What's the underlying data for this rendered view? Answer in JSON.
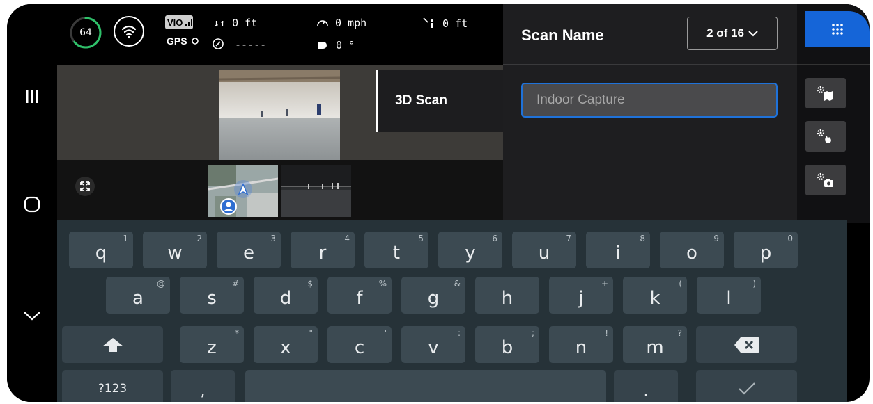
{
  "navbar": {
    "items": [
      {
        "name": "recent-apps",
        "glyph": "|||"
      },
      {
        "name": "home",
        "glyph": "○"
      },
      {
        "name": "back",
        "glyph": "∨"
      }
    ]
  },
  "status": {
    "battery_value": "64",
    "battery_percent": 64,
    "vio_label": "VIO",
    "gps_label": "GPS",
    "altitude": "↓↑ 0 ft",
    "heading": "-----",
    "speed": "0 mph",
    "distance": "0 ft",
    "gimbal_angle": "0 °"
  },
  "camera": {
    "mode_label": "3D Scan"
  },
  "panel": {
    "title": "Scan Name",
    "select_value": "2 of 16",
    "input_placeholder": "Indoor Capture",
    "input_value": ""
  },
  "tools": {
    "icons": [
      "grid-icon",
      "map-settings-icon",
      "fire-settings-icon",
      "camera-settings-icon"
    ]
  },
  "keyboard": {
    "row1": [
      {
        "k": "q",
        "h": "1"
      },
      {
        "k": "w",
        "h": "2"
      },
      {
        "k": "e",
        "h": "3"
      },
      {
        "k": "r",
        "h": "4"
      },
      {
        "k": "t",
        "h": "5"
      },
      {
        "k": "y",
        "h": "6"
      },
      {
        "k": "u",
        "h": "7"
      },
      {
        "k": "i",
        "h": "8"
      },
      {
        "k": "o",
        "h": "9"
      },
      {
        "k": "p",
        "h": "0"
      }
    ],
    "row2": [
      {
        "k": "a",
        "h": "@"
      },
      {
        "k": "s",
        "h": "#"
      },
      {
        "k": "d",
        "h": "$"
      },
      {
        "k": "f",
        "h": "%"
      },
      {
        "k": "g",
        "h": "&"
      },
      {
        "k": "h",
        "h": "-"
      },
      {
        "k": "j",
        "h": "+"
      },
      {
        "k": "k",
        "h": "("
      },
      {
        "k": "l",
        "h": ")"
      }
    ],
    "row3": [
      {
        "k": "z",
        "h": "*"
      },
      {
        "k": "x",
        "h": "\""
      },
      {
        "k": "c",
        "h": "'"
      },
      {
        "k": "v",
        "h": ":"
      },
      {
        "k": "b",
        "h": ";"
      },
      {
        "k": "n",
        "h": "!"
      },
      {
        "k": "m",
        "h": "?"
      }
    ],
    "symbols_label": "?123",
    "comma_label": ",",
    "period_label": ".",
    "colors": {
      "background": "#263238",
      "key": "#3c4a52",
      "accent": "#1565d8"
    }
  }
}
